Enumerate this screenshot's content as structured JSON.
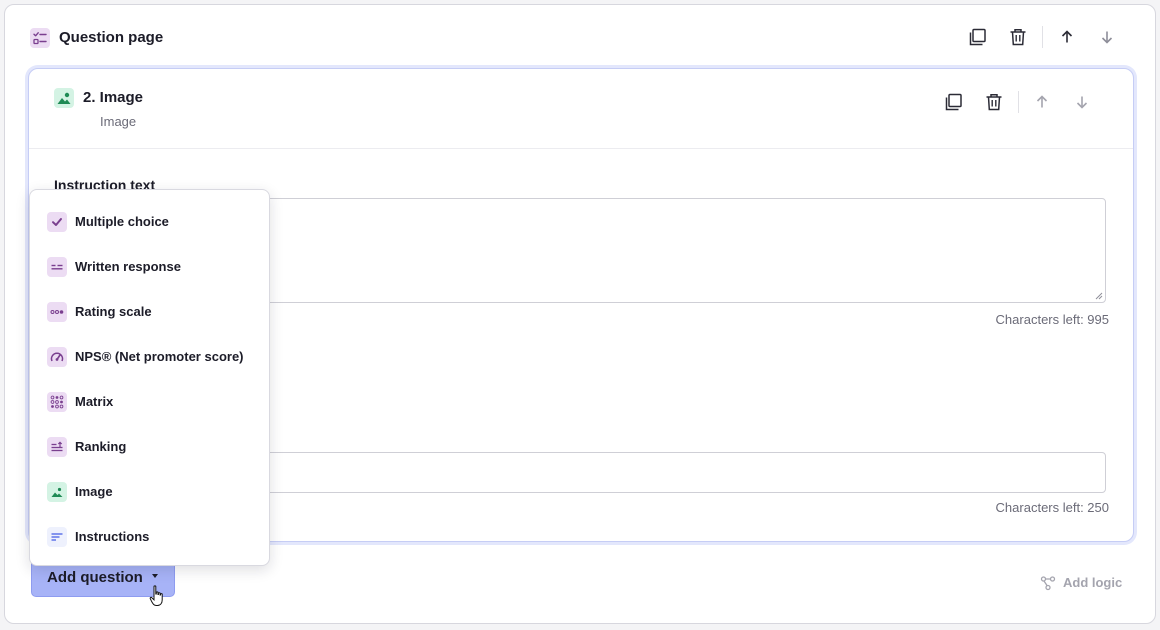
{
  "page": {
    "title": "Question page",
    "icon": "checklist-icon"
  },
  "question": {
    "number_title": "2. Image",
    "type_label": "Image",
    "icon": "image-icon"
  },
  "fields": {
    "instruction_label": "Instruction text",
    "instruction_value": "",
    "instruction_chars_left": "Characters left: 995",
    "second_value": "",
    "second_chars_left": "Characters left: 250"
  },
  "dropdown": {
    "items": [
      {
        "label": "Multiple choice",
        "icon": "checkmark-icon"
      },
      {
        "label": "Written response",
        "icon": "text-lines-icon"
      },
      {
        "label": "Rating scale",
        "icon": "rating-dots-icon"
      },
      {
        "label": "NPS® (Net promoter score)",
        "icon": "gauge-icon"
      },
      {
        "label": "Matrix",
        "icon": "grid-icon"
      },
      {
        "label": "Ranking",
        "icon": "ranking-icon"
      },
      {
        "label": "Image",
        "icon": "image-icon"
      },
      {
        "label": "Instructions",
        "icon": "instructions-icon"
      }
    ]
  },
  "footer": {
    "add_question_label": "Add question",
    "add_logic_label": "Add logic"
  },
  "colors": {
    "accent": "#a7b3f7",
    "purple_icon_bg": "#ecdcf3",
    "purple_icon_fg": "#7a3f8f",
    "green_icon_bg": "#d4f3e4",
    "green_icon_fg": "#1f8a55",
    "blue_icon_fg": "#4b63e6"
  }
}
